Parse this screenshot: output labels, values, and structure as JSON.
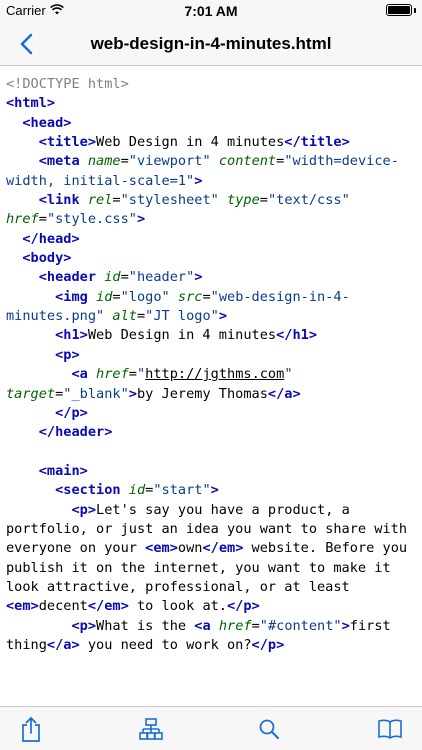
{
  "status": {
    "carrier": "Carrier",
    "time": "7:01 AM",
    "battery_level": 1.0
  },
  "nav": {
    "title": "web-design-in-4-minutes.html"
  },
  "icons": {
    "back": "chevron-left-icon",
    "share": "share-icon",
    "structure": "sitemap-icon",
    "search": "search-icon",
    "book": "book-icon"
  },
  "colors": {
    "accent": "#1a6fd1",
    "tag": "#0a0ab4",
    "attr": "#006400",
    "value": "#0a3c8c",
    "comment": "#808080"
  },
  "code": [
    [
      [
        "c",
        "<!DOCTYPE html>"
      ]
    ],
    [
      [
        "t",
        "<html>"
      ]
    ],
    [
      [
        "p",
        "  "
      ],
      [
        "t",
        "<head>"
      ]
    ],
    [
      [
        "p",
        "    "
      ],
      [
        "t",
        "<title>"
      ],
      [
        "p",
        "Web Design in 4 minutes"
      ],
      [
        "t",
        "</title>"
      ]
    ],
    [
      [
        "p",
        "    "
      ],
      [
        "t",
        "<meta "
      ],
      [
        "a",
        "name"
      ],
      [
        "p",
        "="
      ],
      [
        "v",
        "\"viewport\""
      ],
      [
        "p",
        " "
      ],
      [
        "a",
        "content"
      ],
      [
        "p",
        "="
      ],
      [
        "v",
        "\"width=device-width, initial-scale=1\""
      ],
      [
        "t",
        ">"
      ]
    ],
    [
      [
        "p",
        "    "
      ],
      [
        "t",
        "<link "
      ],
      [
        "a",
        "rel"
      ],
      [
        "p",
        "="
      ],
      [
        "v",
        "\"stylesheet\""
      ],
      [
        "p",
        " "
      ],
      [
        "a",
        "type"
      ],
      [
        "p",
        "="
      ],
      [
        "v",
        "\"text/css\""
      ],
      [
        "p",
        " "
      ],
      [
        "a",
        "href"
      ],
      [
        "p",
        "="
      ],
      [
        "v",
        "\"style.css\""
      ],
      [
        "t",
        ">"
      ]
    ],
    [
      [
        "p",
        "  "
      ],
      [
        "t",
        "</head>"
      ]
    ],
    [
      [
        "p",
        "  "
      ],
      [
        "t",
        "<body>"
      ]
    ],
    [
      [
        "p",
        "    "
      ],
      [
        "t",
        "<header "
      ],
      [
        "a",
        "id"
      ],
      [
        "p",
        "="
      ],
      [
        "v",
        "\"header\""
      ],
      [
        "t",
        ">"
      ]
    ],
    [
      [
        "p",
        "      "
      ],
      [
        "t",
        "<img "
      ],
      [
        "a",
        "id"
      ],
      [
        "p",
        "="
      ],
      [
        "v",
        "\"logo\""
      ],
      [
        "p",
        " "
      ],
      [
        "a",
        "src"
      ],
      [
        "p",
        "="
      ],
      [
        "v",
        "\"web-design-in-4-minutes.png\""
      ],
      [
        "p",
        " "
      ],
      [
        "a",
        "alt"
      ],
      [
        "p",
        "="
      ],
      [
        "v",
        "\"JT logo\""
      ],
      [
        "t",
        ">"
      ]
    ],
    [
      [
        "p",
        "      "
      ],
      [
        "t",
        "<h1>"
      ],
      [
        "p",
        "Web Design in 4 minutes"
      ],
      [
        "t",
        "</h1>"
      ]
    ],
    [
      [
        "p",
        "      "
      ],
      [
        "t",
        "<p>"
      ]
    ],
    [
      [
        "p",
        "        "
      ],
      [
        "t",
        "<a "
      ],
      [
        "a",
        "href"
      ],
      [
        "p",
        "="
      ],
      [
        "v",
        "\""
      ],
      [
        "u",
        "http://jgthms.com"
      ],
      [
        "v",
        "\""
      ],
      [
        "p",
        " "
      ],
      [
        "a",
        "target"
      ],
      [
        "p",
        "="
      ],
      [
        "v",
        "\"_blank\""
      ],
      [
        "t",
        ">"
      ],
      [
        "p",
        "by Jeremy Thomas"
      ],
      [
        "t",
        "</a>"
      ]
    ],
    [
      [
        "p",
        "      "
      ],
      [
        "t",
        "</p>"
      ]
    ],
    [
      [
        "p",
        "    "
      ],
      [
        "t",
        "</header>"
      ]
    ],
    [
      [
        "p",
        ""
      ]
    ],
    [
      [
        "p",
        "    "
      ],
      [
        "t",
        "<main>"
      ]
    ],
    [
      [
        "p",
        "      "
      ],
      [
        "t",
        "<section "
      ],
      [
        "a",
        "id"
      ],
      [
        "p",
        "="
      ],
      [
        "v",
        "\"start\""
      ],
      [
        "t",
        ">"
      ]
    ],
    [
      [
        "p",
        "        "
      ],
      [
        "t",
        "<p>"
      ],
      [
        "p",
        "Let's say you have a product, a portfolio, or just an idea you want to share with everyone on your "
      ],
      [
        "t",
        "<em>"
      ],
      [
        "p",
        "own"
      ],
      [
        "t",
        "</em>"
      ],
      [
        "p",
        " website. Before you publish it on the internet, you want to make it look attractive, professional, or at least "
      ],
      [
        "t",
        "<em>"
      ],
      [
        "p",
        "decent"
      ],
      [
        "t",
        "</em>"
      ],
      [
        "p",
        " to look at."
      ],
      [
        "t",
        "</p>"
      ]
    ],
    [
      [
        "p",
        "        "
      ],
      [
        "t",
        "<p>"
      ],
      [
        "p",
        "What is the "
      ],
      [
        "t",
        "<a "
      ],
      [
        "a",
        "href"
      ],
      [
        "p",
        "="
      ],
      [
        "v",
        "\"#content\""
      ],
      [
        "t",
        ">"
      ],
      [
        "p",
        "first thing"
      ],
      [
        "t",
        "</a>"
      ],
      [
        "p",
        " you need to work on?"
      ],
      [
        "t",
        "</p>"
      ]
    ]
  ]
}
